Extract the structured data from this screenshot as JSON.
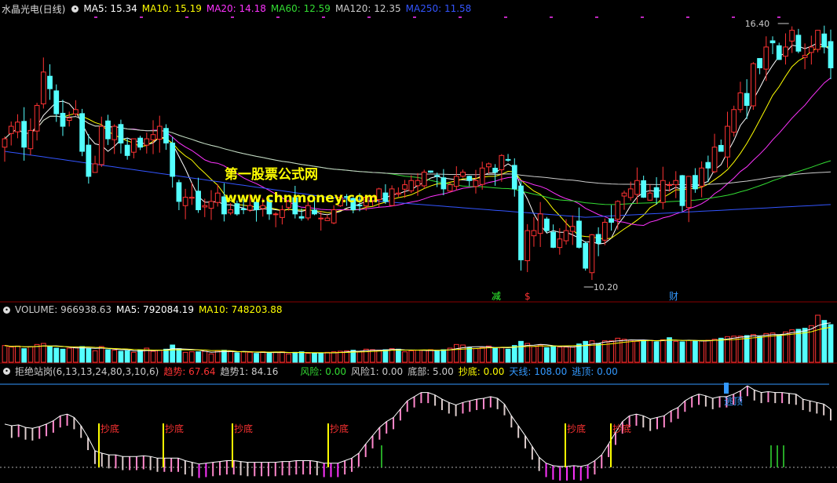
{
  "main_panel": {
    "title": "水晶光电(日线)",
    "ma": [
      {
        "label": "MA5: 15.34",
        "color": "#ffffff"
      },
      {
        "label": "MA10: 15.19",
        "color": "#ffff00"
      },
      {
        "label": "MA20: 14.18",
        "color": "#ff33ff"
      },
      {
        "label": "MA60: 12.59",
        "color": "#33dd33"
      },
      {
        "label": "MA120: 12.35",
        "color": "#cccccc"
      },
      {
        "label": "MA250: 11.58",
        "color": "#3355ff"
      }
    ],
    "high_label": "16.40",
    "low_label": "10.20",
    "signals": [
      {
        "text": "减",
        "color": "#33ff33"
      },
      {
        "text": "$",
        "color": "#ff3333"
      },
      {
        "text": "财",
        "color": "#3399ff"
      }
    ],
    "watermark_1": "第一股票公式网",
    "watermark_2": "www.chnmoney.com"
  },
  "volume_panel": {
    "items": [
      {
        "label": "VOLUME: 966938.63",
        "color": "#cccccc"
      },
      {
        "label": "MA5: 792084.19",
        "color": "#ffffff"
      },
      {
        "label": "MA10: 748203.88",
        "color": "#ffff00"
      }
    ]
  },
  "indicator_panel": {
    "name": "拒绝站岗(6,13,13,24,80,3,10,6)",
    "items": [
      {
        "label": "趋势: 67.64",
        "color": "#ff3333"
      },
      {
        "label": "趋势1: 84.16",
        "color": "#cccccc"
      },
      {
        "label": "风险: 0.00",
        "color": "#33dd33"
      },
      {
        "label": "风险1: 0.00",
        "color": "#cccccc"
      },
      {
        "label": "底部: 5.00",
        "color": "#cccccc"
      },
      {
        "label": "抄底: 0.00",
        "color": "#ffff00"
      },
      {
        "label": "天线: 108.00",
        "color": "#3399ff"
      },
      {
        "label": "逃顶: 0.00",
        "color": "#3399ff"
      }
    ],
    "buy_label": "抄底",
    "escape_label": "逃顶"
  },
  "chart_data": {
    "type": "candlestick",
    "close": [
      13.6,
      13.9,
      14.0,
      13.4,
      13.8,
      14.4,
      15.2,
      14.8,
      14.2,
      13.9,
      14.1,
      14.3,
      13.3,
      12.7,
      13.0,
      13.9,
      13.6,
      13.9,
      13.5,
      13.2,
      13.6,
      13.4,
      13.6,
      13.7,
      13.9,
      13.5,
      12.7,
      12.1,
      12.2,
      12.2,
      11.9,
      12.0,
      12.1,
      12.3,
      11.8,
      11.9,
      11.8,
      11.9,
      12.0,
      11.9,
      12.0,
      11.8,
      11.8,
      11.9,
      12.1,
      11.8,
      11.7,
      12.0,
      11.8,
      11.7,
      11.7,
      11.9,
      12.2,
      12.2,
      11.9,
      12.0,
      12.2,
      12.2,
      12.4,
      12.1,
      12.4,
      12.3,
      12.5,
      12.6,
      12.6,
      12.8,
      12.8,
      12.7,
      12.4,
      12.5,
      12.7,
      12.8,
      12.6,
      12.6,
      12.9,
      13.0,
      12.8,
      13.2,
      13.1,
      12.4,
      10.7,
      11.4,
      11.4,
      11.8,
      11.4,
      11.0,
      11.2,
      11.4,
      11.5,
      11.0,
      10.5,
      11.3,
      11.1,
      11.6,
      11.6,
      12.1,
      12.3,
      12.4,
      12.6,
      12.2,
      12.3,
      12.2,
      12.6,
      12.5,
      12.6,
      12.0,
      12.7,
      12.4,
      12.9,
      12.9,
      13.4,
      13.3,
      13.9,
      14.3,
      14.7,
      14.4,
      15.4,
      15.3,
      15.8,
      15.9,
      15.5,
      15.8,
      16.2,
      15.7,
      15.6,
      15.8,
      16.2,
      15.8,
      15.3
    ],
    "volume": [
      0.32,
      0.29,
      0.31,
      0.26,
      0.3,
      0.34,
      0.36,
      0.3,
      0.27,
      0.25,
      0.27,
      0.28,
      0.3,
      0.26,
      0.22,
      0.3,
      0.24,
      0.23,
      0.21,
      0.22,
      0.19,
      0.23,
      0.27,
      0.21,
      0.23,
      0.25,
      0.33,
      0.26,
      0.19,
      0.2,
      0.2,
      0.21,
      0.16,
      0.22,
      0.23,
      0.21,
      0.18,
      0.2,
      0.19,
      0.17,
      0.2,
      0.18,
      0.19,
      0.2,
      0.16,
      0.19,
      0.2,
      0.17,
      0.17,
      0.17,
      0.19,
      0.2,
      0.21,
      0.22,
      0.23,
      0.2,
      0.25,
      0.24,
      0.23,
      0.24,
      0.26,
      0.25,
      0.2,
      0.22,
      0.23,
      0.23,
      0.24,
      0.21,
      0.24,
      0.27,
      0.34,
      0.33,
      0.28,
      0.26,
      0.28,
      0.31,
      0.27,
      0.28,
      0.25,
      0.32,
      0.4,
      0.36,
      0.3,
      0.33,
      0.28,
      0.31,
      0.29,
      0.29,
      0.29,
      0.35,
      0.4,
      0.41,
      0.36,
      0.41,
      0.41,
      0.46,
      0.44,
      0.42,
      0.4,
      0.42,
      0.42,
      0.39,
      0.43,
      0.47,
      0.4,
      0.39,
      0.42,
      0.41,
      0.41,
      0.42,
      0.44,
      0.46,
      0.49,
      0.5,
      0.5,
      0.51,
      0.53,
      0.49,
      0.55,
      0.56,
      0.52,
      0.58,
      0.62,
      0.63,
      0.65,
      0.7,
      0.9,
      0.8,
      0.72
    ],
    "trend": [
      52,
      50,
      51,
      48,
      47,
      49,
      52,
      56,
      62,
      64,
      60,
      50,
      36,
      20,
      17,
      15,
      15,
      13,
      13,
      13,
      14,
      13,
      11,
      11,
      11,
      11,
      8,
      6,
      4,
      5,
      6,
      7,
      8,
      8,
      7,
      6,
      6,
      6,
      6,
      6,
      7,
      7,
      8,
      8,
      8,
      7,
      5,
      5,
      5,
      8,
      11,
      17,
      28,
      38,
      48,
      55,
      60,
      70,
      80,
      85,
      90,
      90,
      87,
      82,
      78,
      75,
      78,
      80,
      82,
      83,
      85,
      83,
      76,
      62,
      50,
      38,
      25,
      12,
      5,
      2,
      1,
      1,
      2,
      1,
      3,
      8,
      15,
      28,
      42,
      55,
      62,
      64,
      62,
      58,
      60,
      62,
      68,
      72,
      80,
      85,
      88,
      86,
      83,
      85,
      85,
      88,
      92,
      98,
      93,
      90,
      91,
      90,
      90,
      89,
      88,
      82,
      80,
      78,
      76,
      70
    ],
    "ma_values": {
      "MA5": 15.34,
      "MA10": 15.19,
      "MA20": 14.18,
      "MA60": 12.59,
      "MA120": 12.35,
      "MA250": 11.58
    },
    "high": 16.4,
    "low": 10.2
  }
}
